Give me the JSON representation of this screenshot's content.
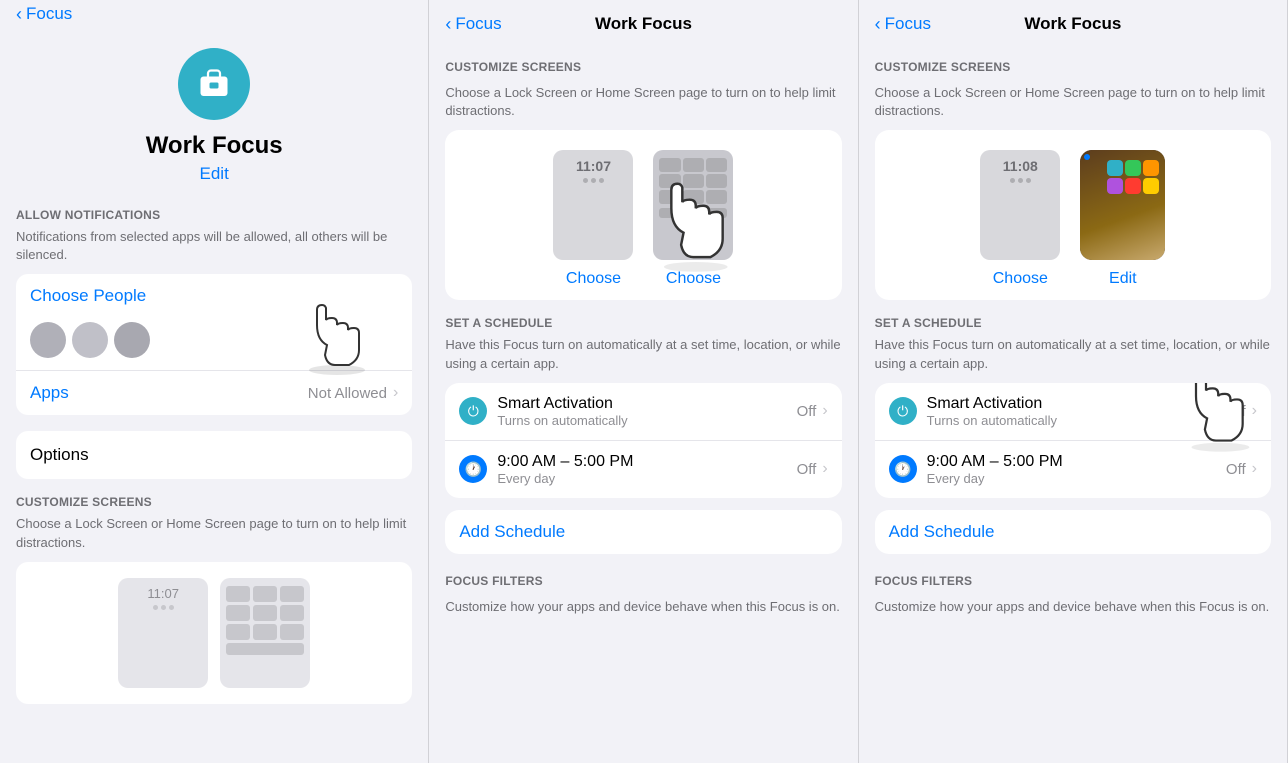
{
  "panels": [
    {
      "id": "panel1",
      "header": {
        "back_label": "Focus",
        "title": ""
      },
      "focus_name": "Work Focus",
      "focus_edit": "Edit",
      "allow_notifications_label": "ALLOW NOTIFICATIONS",
      "allow_notifications_desc": "Notifications from selected apps will be allowed, all others will be silenced.",
      "choose_people_label": "Choose People",
      "apps_label": "Apps",
      "apps_value": "Not Allowed",
      "options_label": "Options",
      "customize_screens_label": "CUSTOMIZE SCREENS",
      "customize_screens_desc": "Choose a Lock Screen or Home Screen page to turn on to help limit distractions.",
      "mock_time": "11:07"
    },
    {
      "id": "panel2",
      "header": {
        "back_label": "Focus",
        "title": "Work Focus"
      },
      "customize_screens_label": "CUSTOMIZE SCREENS",
      "customize_screens_desc": "Choose a Lock Screen or Home Screen page to turn on to help limit distractions.",
      "choose_btn": "Choose",
      "choose_btn2": "Choose",
      "mock_time": "11:07",
      "set_schedule_label": "SET A SCHEDULE",
      "set_schedule_desc": "Have this Focus turn on automatically at a set time, location, or while using a certain app.",
      "smart_activation_title": "Smart Activation",
      "smart_activation_sub": "Turns on automatically",
      "smart_activation_value": "Off",
      "time_range_title": "9:00 AM – 5:00 PM",
      "time_range_sub": "Every day",
      "time_range_value": "Off",
      "add_schedule_label": "Add Schedule",
      "focus_filters_label": "FOCUS FILTERS",
      "focus_filters_desc": "Customize how your apps and device behave when this Focus is on."
    },
    {
      "id": "panel3",
      "header": {
        "back_label": "Focus",
        "title": "Work Focus"
      },
      "customize_screens_label": "CUSTOMIZE SCREENS",
      "customize_screens_desc": "Choose a Lock Screen or Home Screen page to turn on to help limit distractions.",
      "choose_btn": "Choose",
      "edit_btn": "Edit",
      "mock_time": "11:08",
      "set_schedule_label": "SET A SCHEDULE",
      "set_schedule_desc": "Have this Focus turn on automatically at a set time, location, or while using a certain app.",
      "smart_activation_title": "Smart Activation",
      "smart_activation_sub": "Turns on automatically",
      "smart_activation_value": "Off",
      "time_range_title": "9:00 AM – 5:00 PM",
      "time_range_sub": "Every day",
      "time_range_value": "Off",
      "add_schedule_label": "Add Schedule",
      "focus_filters_label": "FOCUS FILTERS",
      "focus_filters_desc": "Customize how your apps and device behave when this Focus is on."
    }
  ]
}
